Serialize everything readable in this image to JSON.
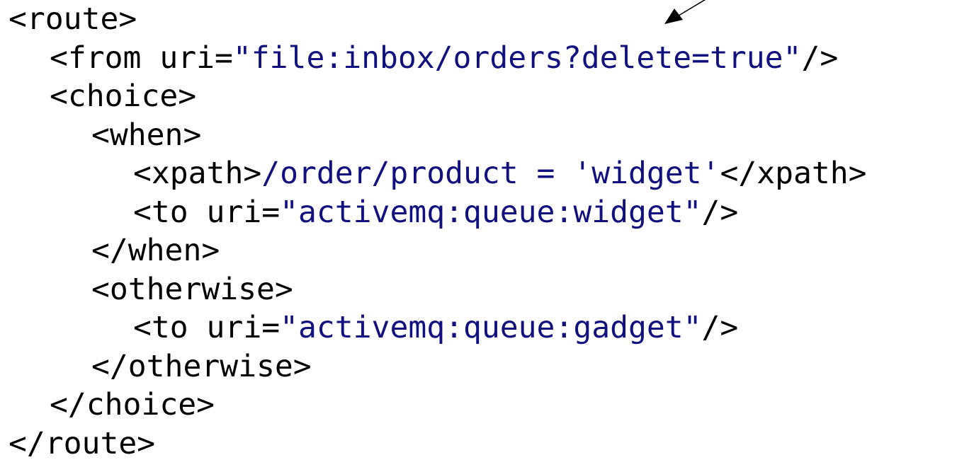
{
  "colors": {
    "text": "#000000",
    "value": "#10107f",
    "background": "#ffffff"
  },
  "code_lines": [
    {
      "indent": 0,
      "parts": [
        {
          "t": "<route>",
          "v": false
        }
      ]
    },
    {
      "indent": 1,
      "parts": [
        {
          "t": "<from uri=",
          "v": false
        },
        {
          "t": "\"file:inbox/orders?delete=true\"",
          "v": true
        },
        {
          "t": "/>",
          "v": false
        }
      ]
    },
    {
      "indent": 1,
      "parts": [
        {
          "t": "<choice>",
          "v": false
        }
      ]
    },
    {
      "indent": 2,
      "parts": [
        {
          "t": "<when>",
          "v": false
        }
      ]
    },
    {
      "indent": 3,
      "parts": [
        {
          "t": "<xpath>",
          "v": false
        },
        {
          "t": "/order/product = 'widget'",
          "v": true
        },
        {
          "t": "</xpath>",
          "v": false
        }
      ]
    },
    {
      "indent": 3,
      "parts": [
        {
          "t": "<to uri=",
          "v": false
        },
        {
          "t": "\"activemq:queue:widget\"",
          "v": true
        },
        {
          "t": "/>",
          "v": false
        }
      ]
    },
    {
      "indent": 2,
      "parts": [
        {
          "t": "</when>",
          "v": false
        }
      ]
    },
    {
      "indent": 2,
      "parts": [
        {
          "t": "<otherwise>",
          "v": false
        }
      ]
    },
    {
      "indent": 3,
      "parts": [
        {
          "t": "<to uri=",
          "v": false
        },
        {
          "t": "\"activemq:queue:gadget\"",
          "v": true
        },
        {
          "t": "/>",
          "v": false
        }
      ]
    },
    {
      "indent": 2,
      "parts": [
        {
          "t": "</otherwise>",
          "v": false
        }
      ]
    },
    {
      "indent": 1,
      "parts": [
        {
          "t": "</choice>",
          "v": false
        }
      ]
    },
    {
      "indent": 0,
      "parts": [
        {
          "t": "</route>",
          "v": false
        }
      ]
    }
  ],
  "annotation": {
    "icon": "arrow-pointer-icon"
  }
}
